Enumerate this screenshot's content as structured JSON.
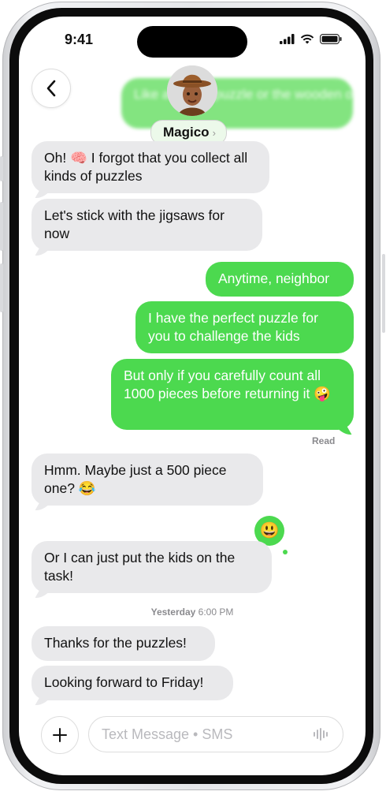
{
  "status_bar": {
    "time": "9:41"
  },
  "contact": {
    "name": "Magico",
    "chevron": "›"
  },
  "background_message": {
    "text": "Like a jigsaw puzzle or the wooden or metal brain teasers?"
  },
  "messages": [
    {
      "direction": "incoming",
      "text": "Oh! 🧠 I forgot that you collect all kinds of puzzles"
    },
    {
      "direction": "incoming",
      "text": "Let's stick with the jigsaws for now"
    },
    {
      "direction": "outgoing",
      "text": "Anytime, neighbor"
    },
    {
      "direction": "outgoing",
      "text": "I have the perfect puzzle for you to challenge the kids"
    },
    {
      "direction": "outgoing",
      "text": "But only if you carefully count all 1000 pieces before returning it 🤪"
    },
    {
      "direction": "incoming",
      "text": "Hmm. Maybe just a 500 piece one? 😂"
    },
    {
      "direction": "incoming",
      "text": "Or I can just put the kids on the task!"
    },
    {
      "direction": "incoming",
      "text": "Thanks for the puzzles!"
    },
    {
      "direction": "incoming",
      "text": "Looking forward to Friday!"
    }
  ],
  "receipt": "Read",
  "tapback": {
    "emoji": "😃"
  },
  "timestamp": {
    "day": "Yesterday",
    "time": "6:00 PM"
  },
  "composer": {
    "placeholder": "Text Message • SMS"
  },
  "colors": {
    "outgoing_bubble": "#4cd94f",
    "incoming_bubble": "#e9e9eb"
  },
  "icons": [
    "back-chevron-icon",
    "plus-icon",
    "dictation-icon",
    "signal-icon",
    "wifi-icon",
    "battery-icon"
  ]
}
